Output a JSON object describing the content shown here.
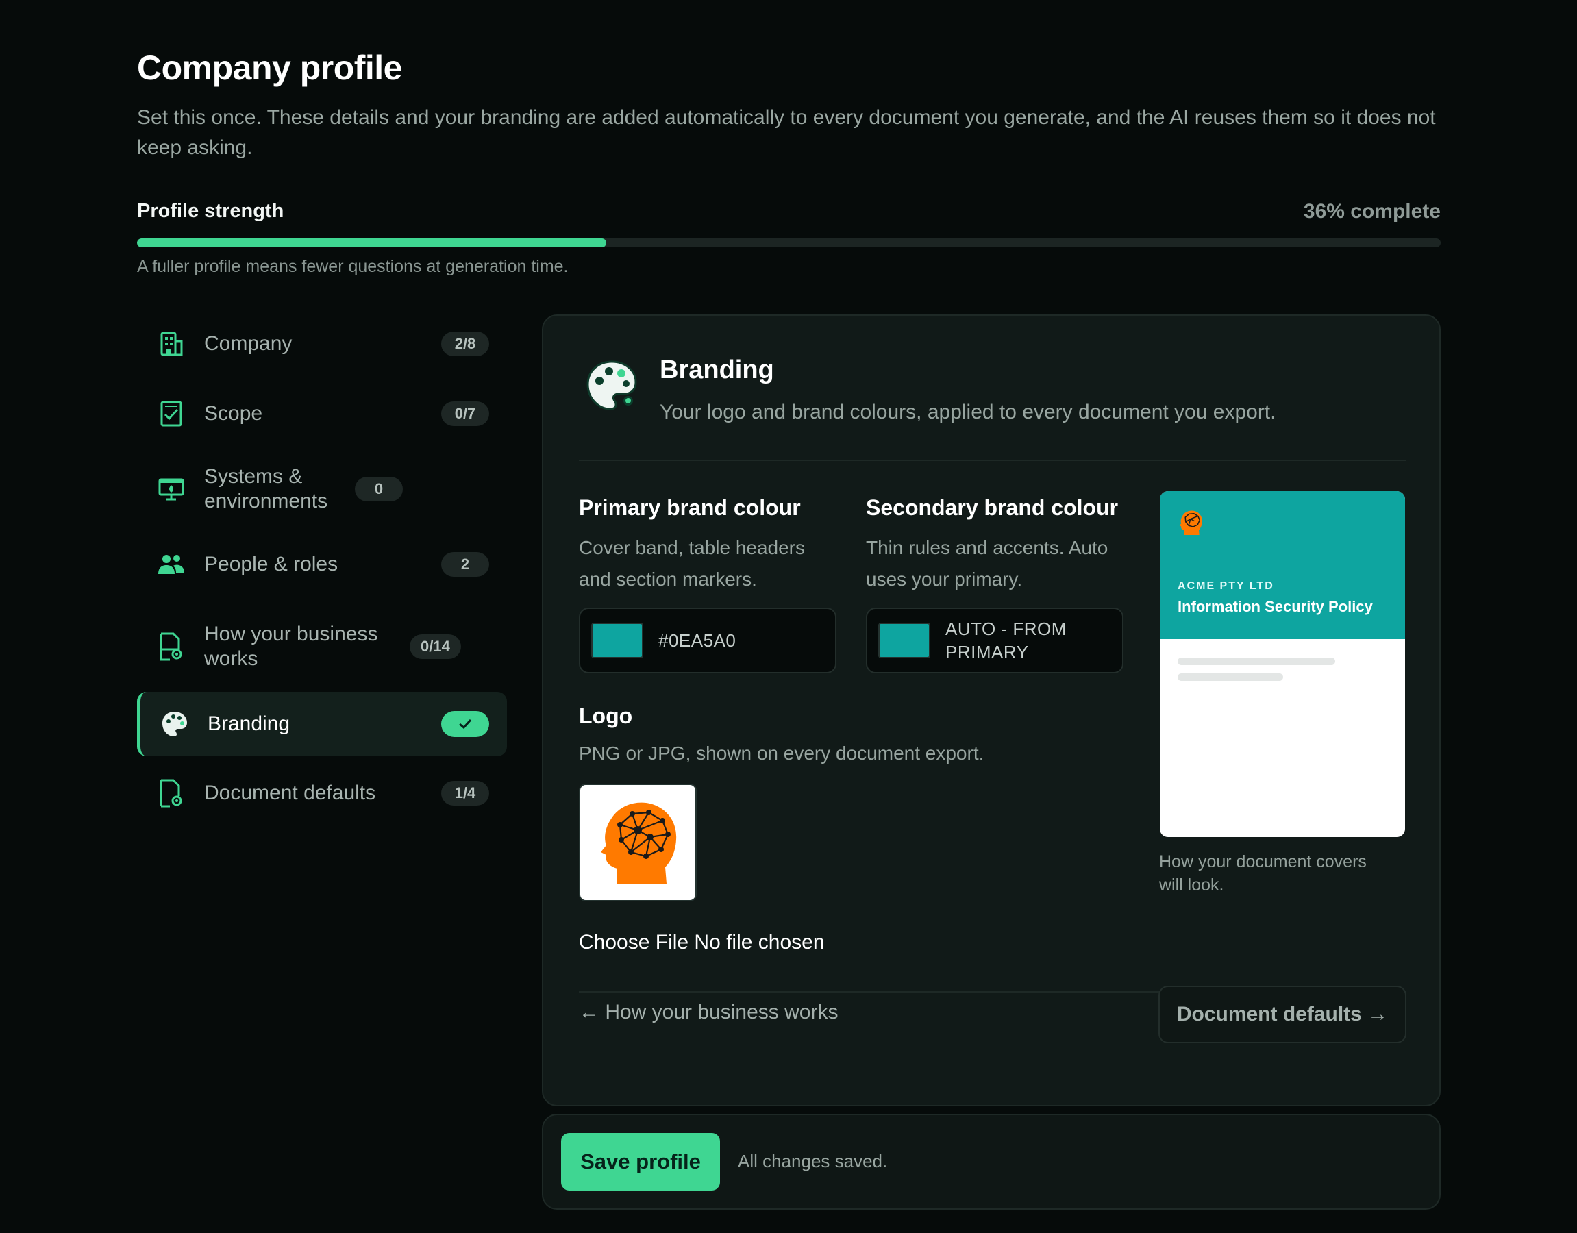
{
  "header": {
    "title": "Company profile",
    "subtitle": "Set this once. These details and your branding are added automatically to every document you generate, and the AI reuses them so it does not keep asking."
  },
  "strength": {
    "label": "Profile strength",
    "percent_text": "36% complete",
    "fraction": 0.36,
    "hint": "A fuller profile means fewer questions at generation time."
  },
  "sidebar": {
    "items": [
      {
        "label": "Company",
        "badge": "2/8",
        "icon": "building-icon"
      },
      {
        "label": "Scope",
        "badge": "0/7",
        "icon": "checklist-icon"
      },
      {
        "label": "Systems & environments",
        "badge": "0",
        "icon": "monitor-icon"
      },
      {
        "label": "People & roles",
        "badge": "2",
        "icon": "people-icon"
      },
      {
        "label": "How your business works",
        "badge": "0/14",
        "icon": "document-gear-icon"
      },
      {
        "label": "Branding",
        "badge": "✓",
        "icon": "palette-icon",
        "active": true
      },
      {
        "label": "Document defaults",
        "badge": "1/4",
        "icon": "document-gear-icon"
      }
    ]
  },
  "section": {
    "title": "Branding",
    "subtitle": "Your logo and brand colours, applied to every document you export.",
    "icon": "palette-icon"
  },
  "primary_colour": {
    "title": "Primary brand colour",
    "description": "Cover band, table headers and section markers.",
    "value": "#0EA5A0",
    "swatch": "#0EA5A0"
  },
  "secondary_colour": {
    "title": "Secondary brand colour",
    "description": "Thin rules and accents. Auto uses your primary.",
    "value": "AUTO - FROM PRIMARY",
    "swatch": "#0EA5A0"
  },
  "logo": {
    "title": "Logo",
    "description": "PNG or JPG, shown on every document export.",
    "file_input_text": "Choose File No file chosen",
    "icon": "brain-head-logo"
  },
  "preview": {
    "company": "ACME PTY LTD",
    "document_title": "Information Security Policy",
    "caption": "How your document covers will look."
  },
  "navigation": {
    "prev_label": "← How your business works",
    "next_label": "Document defaults →"
  },
  "save_bar": {
    "button_label": "Save profile",
    "status": "All changes saved."
  },
  "colors": {
    "accent": "#3fd692",
    "background": "#060b0a",
    "card": "#111a18",
    "brand_primary": "#0EA5A0",
    "logo_orange": "#ff7a00"
  }
}
